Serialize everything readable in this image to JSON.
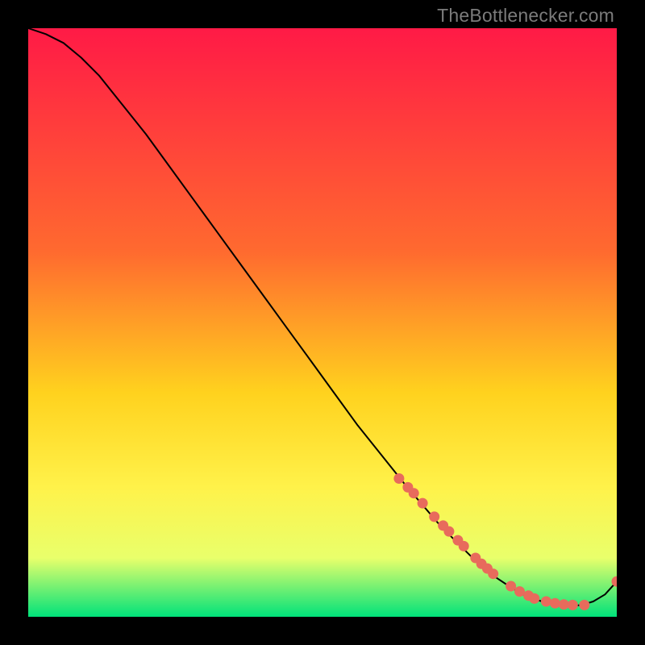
{
  "watermark": "TheBottlenecker.com",
  "colors": {
    "bg": "#000000",
    "grad_top": "#ff1a46",
    "grad_mid1": "#ff6a2f",
    "grad_mid2": "#ffd21e",
    "grad_mid3": "#fff24a",
    "grad_mid4": "#e9ff6b",
    "grad_bottom": "#00e27a",
    "line": "#000000",
    "dot": "#e86b5c"
  },
  "chart_data": {
    "type": "line",
    "title": "",
    "xlabel": "",
    "ylabel": "",
    "xlim": [
      0,
      100
    ],
    "ylim": [
      0,
      100
    ],
    "series": [
      {
        "name": "curve",
        "x": [
          0,
          3,
          6,
          9,
          12,
          16,
          20,
          24,
          28,
          32,
          36,
          40,
          44,
          48,
          52,
          56,
          60,
          64,
          67,
          70,
          73,
          76,
          79,
          82,
          84,
          86,
          88,
          90,
          92,
          94,
          96,
          98,
          100
        ],
        "y": [
          100,
          99,
          97.5,
          95,
          92,
          87,
          82,
          76.5,
          71,
          65.5,
          60,
          54.5,
          49,
          43.5,
          38,
          32.5,
          27.5,
          22.5,
          19,
          15.5,
          12.5,
          9.5,
          7,
          5,
          3.8,
          3,
          2.4,
          2,
          1.8,
          2,
          2.6,
          3.8,
          6
        ]
      }
    ],
    "markers": {
      "name": "dots",
      "x": [
        63,
        64.5,
        65.5,
        67,
        69,
        70.5,
        71.5,
        73,
        74,
        76,
        77,
        78,
        79,
        82,
        83.5,
        85,
        86,
        88,
        89.5,
        91,
        92.5,
        94.5,
        100
      ],
      "y": [
        23.5,
        22,
        21,
        19.3,
        17,
        15.5,
        14.5,
        13,
        12,
        10,
        9,
        8.2,
        7.3,
        5.2,
        4.3,
        3.6,
        3.1,
        2.6,
        2.3,
        2.1,
        2.0,
        2.0,
        6
      ]
    }
  }
}
